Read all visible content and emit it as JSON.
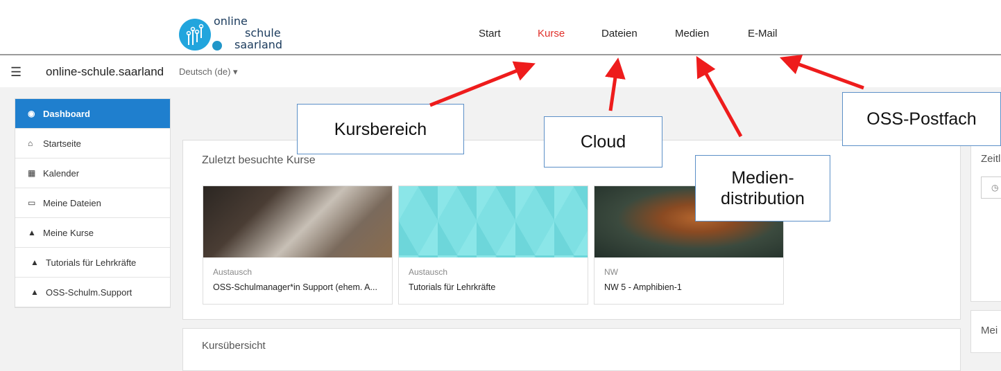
{
  "header": {
    "logo": {
      "line1": "online",
      "line2": "schule",
      "line3": "saarland"
    },
    "nav": [
      "Start",
      "Kurse",
      "Dateien",
      "Medien",
      "E-Mail"
    ],
    "active_nav": "Kurse"
  },
  "subbar": {
    "menu_icon": "hamburger-icon",
    "site_name": "online-schule.saarland",
    "language": "Deutsch (de) ▾"
  },
  "sidebar": {
    "items": [
      {
        "label": "Dashboard",
        "icon": "dashboard-icon",
        "active": true
      },
      {
        "label": "Startseite",
        "icon": "home-icon"
      },
      {
        "label": "Kalender",
        "icon": "calendar-icon"
      },
      {
        "label": "Meine Dateien",
        "icon": "file-icon"
      },
      {
        "label": "Meine Kurse",
        "icon": "graduation-cap-icon"
      },
      {
        "label": "Tutorials für Lehrkräfte",
        "icon": "graduation-cap-icon"
      },
      {
        "label": "OSS-Schulm.Support",
        "icon": "graduation-cap-icon"
      }
    ]
  },
  "recent_courses": {
    "title": "Zuletzt besuchte Kurse",
    "courses": [
      {
        "category": "Austausch",
        "name": "OSS-Schulmanager*in Support (ehem. A..."
      },
      {
        "category": "Austausch",
        "name": "Tutorials für Lehrkräfte"
      },
      {
        "category": "NW",
        "name": "NW 5 - Amphibien-1"
      }
    ]
  },
  "course_overview": {
    "title": "Kursübersicht"
  },
  "right_blocks": {
    "timeline_title": "Zeitl",
    "second_title": "Mei"
  },
  "annotations": {
    "kursbereich": "Kursbereich",
    "cloud": "Cloud",
    "medien_line1": "Medien-",
    "medien_line2": "distribution",
    "postfach": "OSS-Postfach"
  },
  "colors": {
    "accent": "#1f7fce",
    "active_nav": "#e0302a",
    "arrow": "#ee1c1c",
    "callout_border": "#5b8fc7"
  }
}
